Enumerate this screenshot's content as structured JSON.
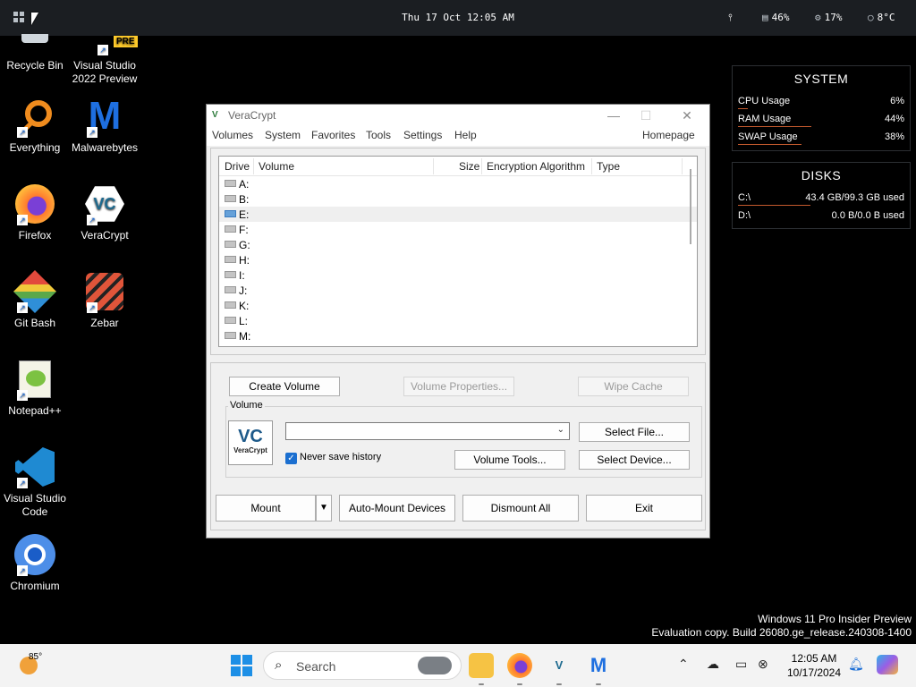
{
  "topbar": {
    "datetime": "Thu 17 Oct 12:05 AM",
    "memory": "46%",
    "cpu": "17%",
    "temperature": "8°C"
  },
  "desktop_icons": [
    {
      "label": "Recycle Bin",
      "icon": "recycle-bin-icon"
    },
    {
      "label": "Visual Studio 2022 Preview",
      "icon": "visual-studio-icon",
      "badge": "PRE"
    },
    {
      "label": "Everything",
      "icon": "everything-search-icon"
    },
    {
      "label": "Malwarebytes",
      "icon": "malwarebytes-icon"
    },
    {
      "label": "Firefox",
      "icon": "firefox-icon"
    },
    {
      "label": "VeraCrypt",
      "icon": "veracrypt-icon"
    },
    {
      "label": "Git Bash",
      "icon": "git-bash-icon"
    },
    {
      "label": "Zebar",
      "icon": "zebar-icon"
    },
    {
      "label": "Notepad++",
      "icon": "notepad-plus-plus-icon"
    },
    {
      "label": "Visual Studio Code",
      "icon": "vscode-icon"
    },
    {
      "label": "Chromium",
      "icon": "chromium-icon"
    }
  ],
  "system_widget": {
    "title": "SYSTEM",
    "rows": [
      {
        "label": "CPU Usage",
        "value": "6%",
        "fraction": 0.06
      },
      {
        "label": "RAM Usage",
        "value": "44%",
        "fraction": 0.44
      },
      {
        "label": "SWAP Usage",
        "value": "38%",
        "fraction": 0.38
      }
    ]
  },
  "disks_widget": {
    "title": "DISKS",
    "rows": [
      {
        "label": "C:\\",
        "value": "43.4 GB/99.3 GB used",
        "fraction": 0.437
      },
      {
        "label": "D:\\",
        "value": "0.0 B/0.0 B used",
        "fraction": 0.0
      }
    ]
  },
  "veracrypt": {
    "title": "VeraCrypt",
    "menu": [
      "Volumes",
      "System",
      "Favorites",
      "Tools",
      "Settings",
      "Help"
    ],
    "homepage": "Homepage",
    "columns": [
      "Drive",
      "Volume",
      "Size",
      "Encryption Algorithm",
      "Type"
    ],
    "drives": [
      "A:",
      "B:",
      "E:",
      "F:",
      "G:",
      "H:",
      "I:",
      "J:",
      "K:",
      "L:",
      "M:"
    ],
    "selected_drive": "E:",
    "buttons": {
      "create_volume": "Create Volume",
      "volume_properties": "Volume Properties...",
      "wipe_cache": "Wipe Cache",
      "select_file": "Select File...",
      "volume_tools": "Volume Tools...",
      "select_device": "Select Device...",
      "mount": "Mount",
      "auto_mount": "Auto-Mount Devices",
      "dismount_all": "Dismount All",
      "exit": "Exit"
    },
    "volume_group_label": "Volume",
    "volume_path": "",
    "never_save_history": "Never save history",
    "never_save_history_checked": true,
    "logo_text": "VeraCrypt"
  },
  "watermark": {
    "line1": "Windows 11 Pro Insider Preview",
    "line2": "Evaluation copy. Build 26080.ge_release.240308-1400"
  },
  "taskbar": {
    "weather_temp": "85°",
    "search_placeholder": "Search",
    "time": "12:05 AM",
    "date": "10/17/2024",
    "pinned": [
      "search-highlight-icon",
      "file-explorer-icon",
      "firefox-icon",
      "veracrypt-icon",
      "malwarebytes-icon"
    ],
    "accent": "#1d8fe6"
  }
}
